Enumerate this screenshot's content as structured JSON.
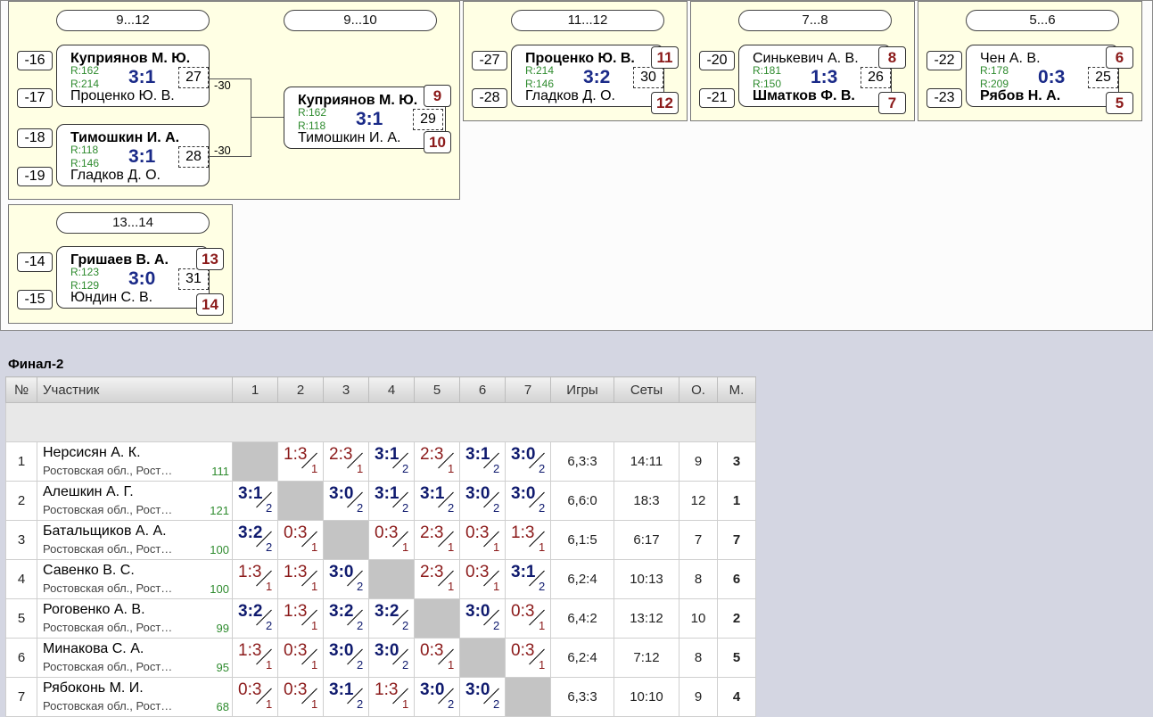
{
  "brackets": [
    {
      "header": "9...12",
      "matches": [
        {
          "seed1": "-16",
          "seed2": "-17",
          "p1": "Куприянов М. Ю.",
          "p2": "Проценко Ю. В.",
          "r1": "R:162",
          "r2": "R:214",
          "score": "3:1",
          "num": "27",
          "loser": "-30",
          "winner": 1
        },
        {
          "seed1": "-18",
          "seed2": "-19",
          "p1": "Тимошкин И. А.",
          "p2": "Гладков Д. О.",
          "r1": "R:118",
          "r2": "R:146",
          "score": "3:1",
          "num": "28",
          "loser": "-30",
          "winner": 1
        }
      ]
    },
    {
      "header": "9...10",
      "matches": [
        {
          "p1": "Куприянов М. Ю.",
          "p2": "Тимошкин И. А.",
          "r1": "R:162",
          "r2": "R:118",
          "score": "3:1",
          "num": "29",
          "place1": "9",
          "place2": "10",
          "winner": 1
        }
      ]
    },
    {
      "header": "11...12",
      "matches": [
        {
          "seed1": "-27",
          "seed2": "-28",
          "p1": "Проценко Ю. В.",
          "p2": "Гладков Д. О.",
          "r1": "R:214",
          "r2": "R:146",
          "score": "3:2",
          "num": "30",
          "place1": "11",
          "place2": "12",
          "winner": 1
        }
      ]
    },
    {
      "header": "7...8",
      "matches": [
        {
          "seed1": "-20",
          "seed2": "-21",
          "p1": "Синькевич А. В.",
          "p2": "Шматков Ф. В.",
          "r1": "R:181",
          "r2": "R:150",
          "score": "1:3",
          "num": "26",
          "place1": "8",
          "place2": "7",
          "winner": 2
        }
      ]
    },
    {
      "header": "5...6",
      "matches": [
        {
          "seed1": "-22",
          "seed2": "-23",
          "p1": "Чен А. В.",
          "p2": "Рябов Н. А.",
          "r1": "R:178",
          "r2": "R:209",
          "score": "0:3",
          "num": "25",
          "place1": "6",
          "place2": "5",
          "winner": 2
        }
      ]
    },
    {
      "header": "13...14",
      "matches": [
        {
          "seed1": "-14",
          "seed2": "-15",
          "p1": "Гришаев В. А.",
          "p2": "Юндин С. В.",
          "r1": "R:123",
          "r2": "R:129",
          "score": "3:0",
          "num": "31",
          "place1": "13",
          "place2": "14",
          "winner": 1
        }
      ]
    }
  ],
  "final": {
    "title": "Финал-2",
    "columns": [
      "№",
      "Участник",
      "1",
      "2",
      "3",
      "4",
      "5",
      "6",
      "7",
      "Игры",
      "Сеты",
      "О.",
      "М."
    ],
    "rows": [
      {
        "n": "1",
        "name": "Нерсисян А. К.",
        "region": "Ростовская обл., Рост…",
        "rating": "111",
        "cells": [
          null,
          [
            "1:3",
            "1"
          ],
          [
            "2:3",
            "1"
          ],
          [
            "3:1",
            "2"
          ],
          [
            "2:3",
            "1"
          ],
          [
            "3:1",
            "2"
          ],
          [
            "3:0",
            "2"
          ]
        ],
        "games": "6,3:3",
        "sets": "14:11",
        "pts": "9",
        "place": "3"
      },
      {
        "n": "2",
        "name": "Алешкин А. Г.",
        "region": "Ростовская обл., Рост…",
        "rating": "121",
        "cells": [
          [
            "3:1",
            "2"
          ],
          null,
          [
            "3:0",
            "2"
          ],
          [
            "3:1",
            "2"
          ],
          [
            "3:1",
            "2"
          ],
          [
            "3:0",
            "2"
          ],
          [
            "3:0",
            "2"
          ]
        ],
        "games": "6,6:0",
        "sets": "18:3",
        "pts": "12",
        "place": "1"
      },
      {
        "n": "3",
        "name": "Батальщиков А. А.",
        "region": "Ростовская обл., Рост…",
        "rating": "100",
        "cells": [
          [
            "3:2",
            "2"
          ],
          [
            "0:3",
            "1"
          ],
          null,
          [
            "0:3",
            "1"
          ],
          [
            "2:3",
            "1"
          ],
          [
            "0:3",
            "1"
          ],
          [
            "1:3",
            "1"
          ]
        ],
        "games": "6,1:5",
        "sets": "6:17",
        "pts": "7",
        "place": "7"
      },
      {
        "n": "4",
        "name": "Савенко В. С.",
        "region": "Ростовская обл., Рост…",
        "rating": "100",
        "cells": [
          [
            "1:3",
            "1"
          ],
          [
            "1:3",
            "1"
          ],
          [
            "3:0",
            "2"
          ],
          null,
          [
            "2:3",
            "1"
          ],
          [
            "0:3",
            "1"
          ],
          [
            "3:1",
            "2"
          ]
        ],
        "games": "6,2:4",
        "sets": "10:13",
        "pts": "8",
        "place": "6"
      },
      {
        "n": "5",
        "name": "Роговенко А. В.",
        "region": "Ростовская обл., Рост…",
        "rating": "99",
        "cells": [
          [
            "3:2",
            "2"
          ],
          [
            "1:3",
            "1"
          ],
          [
            "3:2",
            "2"
          ],
          [
            "3:2",
            "2"
          ],
          null,
          [
            "3:0",
            "2"
          ],
          [
            "0:3",
            "1"
          ]
        ],
        "games": "6,4:2",
        "sets": "13:12",
        "pts": "10",
        "place": "2"
      },
      {
        "n": "6",
        "name": "Минакова С. А.",
        "region": "Ростовская обл., Рост…",
        "rating": "95",
        "cells": [
          [
            "1:3",
            "1"
          ],
          [
            "0:3",
            "1"
          ],
          [
            "3:0",
            "2"
          ],
          [
            "3:0",
            "2"
          ],
          [
            "0:3",
            "1"
          ],
          null,
          [
            "0:3",
            "1"
          ]
        ],
        "games": "6,2:4",
        "sets": "7:12",
        "pts": "8",
        "place": "5"
      },
      {
        "n": "7",
        "name": "Рябоконь М. И.",
        "region": "Ростовская обл., Рост…",
        "rating": "68",
        "cells": [
          [
            "0:3",
            "1"
          ],
          [
            "0:3",
            "1"
          ],
          [
            "3:1",
            "2"
          ],
          [
            "1:3",
            "1"
          ],
          [
            "3:0",
            "2"
          ],
          [
            "3:0",
            "2"
          ],
          null
        ],
        "games": "6,3:3",
        "sets": "10:10",
        "pts": "9",
        "place": "4"
      }
    ]
  },
  "colors": {
    "bracket_bg": "#ffffe4",
    "win": "#0f1a6e",
    "loss": "#8b1a1a",
    "rating": "#2e8b2e",
    "diag": "#c4c4c4"
  }
}
